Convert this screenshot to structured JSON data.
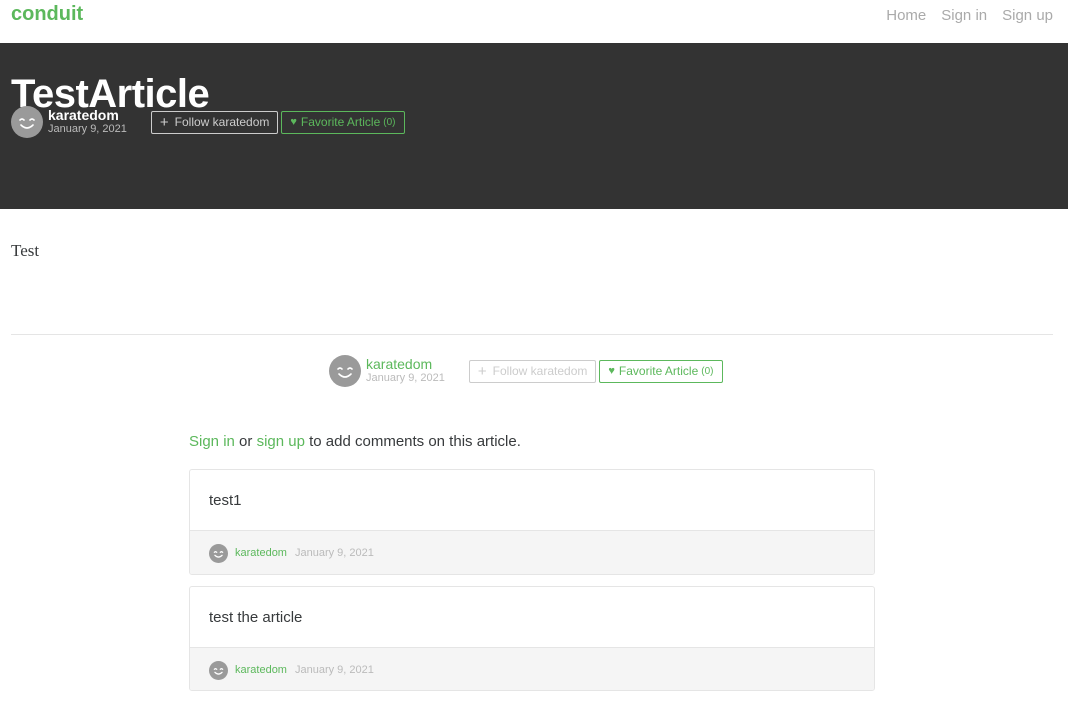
{
  "nav": {
    "brand": "conduit",
    "links": [
      "Home",
      "Sign in",
      "Sign up"
    ]
  },
  "article": {
    "title": "TestArticle",
    "author": "karatedom",
    "date": "January 9, 2021",
    "follow_label": "Follow karatedom",
    "favorite_label": "Favorite Article",
    "favorite_count": "(0)",
    "body": "Test"
  },
  "comments_section": {
    "sign_in": "Sign in",
    "or": "or",
    "sign_up": "sign up",
    "suffix": "to add comments on this article."
  },
  "comments": [
    {
      "text": "test1",
      "author": "karatedom",
      "date": "January 9, 2021"
    },
    {
      "text": "test the article",
      "author": "karatedom",
      "date": "January 9, 2021"
    }
  ],
  "colors": {
    "accent": "#5cb85c",
    "banner": "#333333"
  },
  "icons": [
    "smiley-avatar-icon",
    "plus-icon",
    "heart-icon"
  ]
}
